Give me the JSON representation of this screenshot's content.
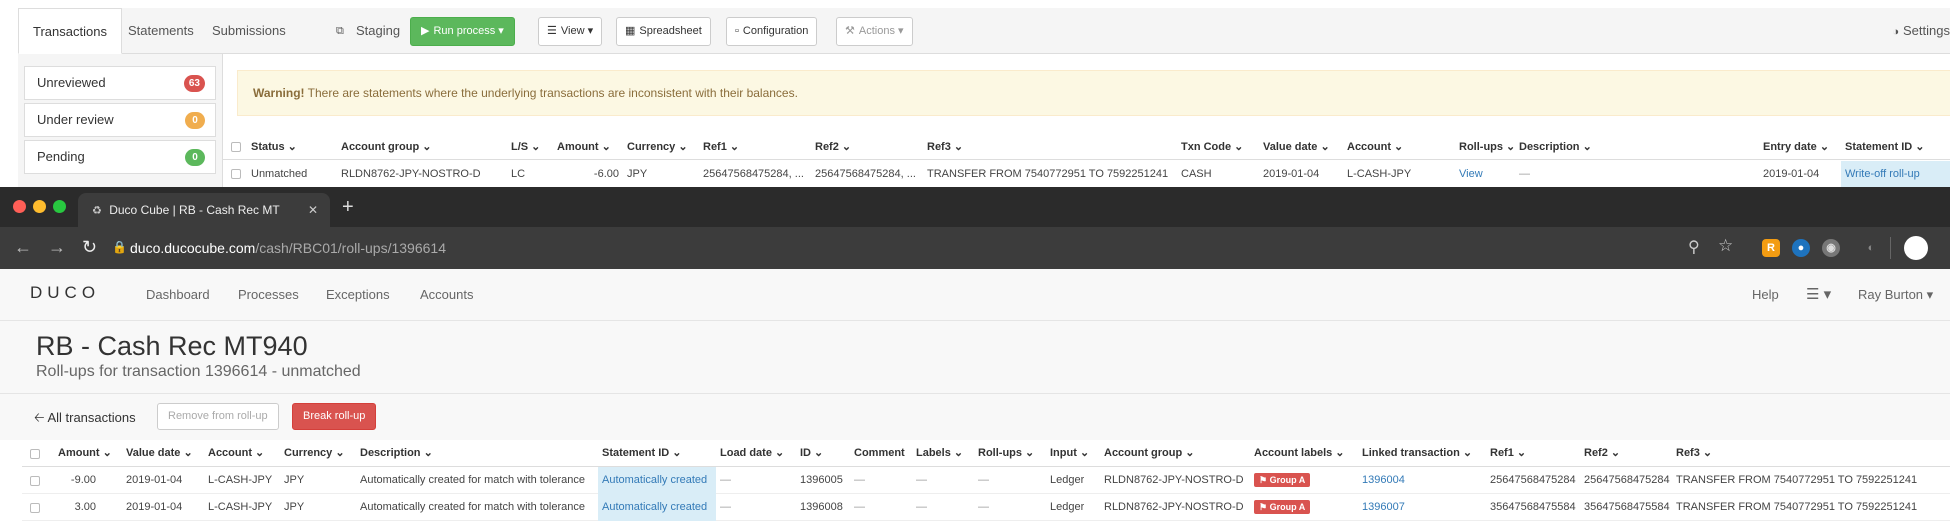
{
  "top_app": {
    "tabs": [
      "Transactions",
      "Statements",
      "Submissions",
      "Staging"
    ],
    "toolbar": {
      "run_process": "Run process",
      "view": "View",
      "spreadsheet": "Spreadsheet",
      "configuration": "Configuration",
      "actions": "Actions",
      "settings": "Settings"
    },
    "filters": [
      {
        "label": "Unreviewed",
        "count": "63",
        "color": "#d9534f"
      },
      {
        "label": "Under review",
        "count": "0",
        "color": "#f0ad4e"
      },
      {
        "label": "Pending",
        "count": "0",
        "color": "#5cb85c"
      }
    ],
    "warning": {
      "strong": "Warning!",
      "text": "There are statements where the underlying transactions are inconsistent with their balances."
    },
    "table": {
      "headers": [
        "Status",
        "Account group",
        "L/S",
        "Amount",
        "Currency",
        "Ref1",
        "Ref2",
        "Ref3",
        "Txn Code",
        "Value date",
        "Account",
        "Roll-ups",
        "Description",
        "Entry date",
        "Statement ID"
      ],
      "row": {
        "status": "Unmatched",
        "account_group": "RLDN8762-JPY-NOSTRO-D",
        "ls": "LC",
        "amount": "-6.00",
        "currency": "JPY",
        "ref1": "25647568475284, ...",
        "ref2": "25647568475284, ...",
        "ref3": "TRANSFER FROM 7540772951 TO 7592251241",
        "txn_code": "CASH",
        "value_date": "2019-01-04",
        "account": "L-CASH-JPY",
        "rollups": "View",
        "description": "—",
        "entry_date": "2019-01-04",
        "statement_id": "Write-off roll-up"
      }
    }
  },
  "browser": {
    "tab_title": "Duco Cube | RB - Cash Rec MT",
    "url_host": "duco.ducocube.com",
    "url_path": "/cash/RBC01/roll-ups/1396614"
  },
  "duco": {
    "logo": "DUCO",
    "nav": [
      "Dashboard",
      "Processes",
      "Exceptions",
      "Accounts"
    ],
    "help": "Help",
    "user": "Ray Burton",
    "title": "RB - Cash Rec MT940",
    "subtitle": "Roll-ups for transaction 1396614 - unmatched",
    "back": "All transactions",
    "remove_button": "Remove from roll-up",
    "break_button": "Break roll-up",
    "table": {
      "headers": [
        "Amount",
        "Value date",
        "Account",
        "Currency",
        "Description",
        "Statement ID",
        "Load date",
        "ID",
        "Comment",
        "Labels",
        "Roll-ups",
        "Input",
        "Account group",
        "Account labels",
        "Linked transaction",
        "Ref1",
        "Ref2",
        "Ref3"
      ],
      "rows": [
        {
          "amount": "-9.00",
          "value_date": "2019-01-04",
          "account": "L-CASH-JPY",
          "currency": "JPY",
          "description": "Automatically created for match with tolerance",
          "statement_id": "Automatically created",
          "load_date": "—",
          "id": "1396005",
          "comment": "—",
          "labels": "—",
          "rollups": "—",
          "input": "Ledger",
          "account_group": "RLDN8762-JPY-NOSTRO-D",
          "account_label": "Group A",
          "linked": "1396004",
          "ref1": "25647568475284",
          "ref2": "25647568475284",
          "ref3": "TRANSFER FROM 7540772951 TO 7592251241"
        },
        {
          "amount": "3.00",
          "value_date": "2019-01-04",
          "account": "L-CASH-JPY",
          "currency": "JPY",
          "description": "Automatically created for match with tolerance",
          "statement_id": "Automatically created",
          "load_date": "—",
          "id": "1396008",
          "comment": "—",
          "labels": "—",
          "rollups": "—",
          "input": "Ledger",
          "account_group": "RLDN8762-JPY-NOSTRO-D",
          "account_label": "Group A",
          "linked": "1396007",
          "ref1": "35647568475584",
          "ref2": "35647568475584",
          "ref3": "TRANSFER FROM 7540772951 TO 7592251241"
        }
      ]
    }
  },
  "colors": {
    "accent_green": "#5cb85c",
    "danger_red": "#d9534f",
    "link_blue": "#337ab7",
    "highlight_blue": "#d9edf7"
  }
}
